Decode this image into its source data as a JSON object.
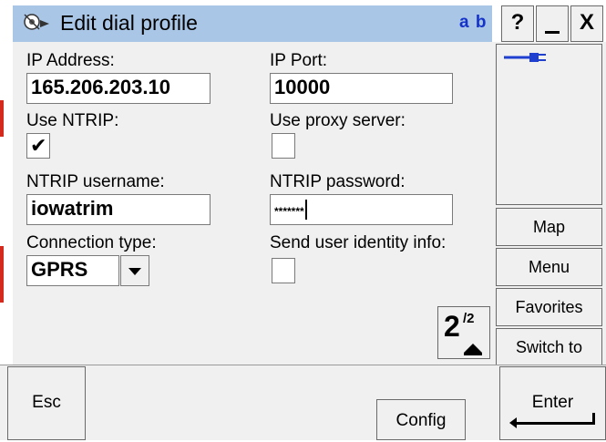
{
  "window": {
    "title": "Edit dial profile",
    "input_mode": "a b",
    "help_label": "?",
    "minimize_label": "_",
    "close_label": "X"
  },
  "form": {
    "ip_address_label": "IP Address:",
    "ip_address_value": "165.206.203.10",
    "ip_port_label": "IP Port:",
    "ip_port_value": "10000",
    "use_ntrip_label": "Use NTRIP:",
    "use_ntrip_checked": true,
    "use_ntrip_mark": "✔",
    "use_proxy_label": "Use proxy server:",
    "use_proxy_checked": false,
    "ntrip_username_label": "NTRIP username:",
    "ntrip_username_value": "iowatrim",
    "ntrip_password_label": "NTRIP password:",
    "ntrip_password_value": "*******",
    "connection_type_label": "Connection type:",
    "connection_type_value": "GPRS",
    "send_identity_label": "Send user identity info:",
    "send_identity_checked": false
  },
  "pager": {
    "current": "2",
    "total": "/2"
  },
  "side_buttons": {
    "map": "Map",
    "menu": "Menu",
    "favorites": "Favorites",
    "switch_to": "Switch to"
  },
  "bottom_buttons": {
    "esc": "Esc",
    "config": "Config",
    "enter": "Enter"
  },
  "colors": {
    "title_bar": "#a9c6e6",
    "input_mode_text": "#1533c8",
    "connection_icon": "#1f3fd0",
    "panel": "#f0f0f0"
  }
}
